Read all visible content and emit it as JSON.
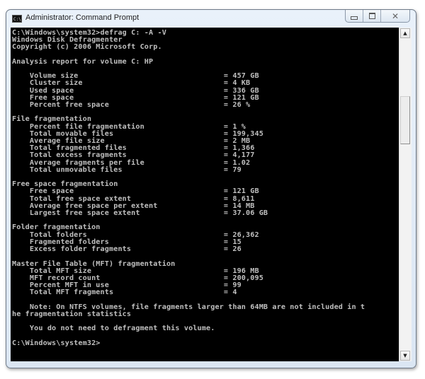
{
  "window": {
    "title": "Administrator: Command Prompt",
    "icon": "cmd-icon",
    "icon_text": "C:\\.",
    "controls": {
      "minimize": "minimize-icon",
      "maximize": "maximize-icon",
      "close": "close-icon",
      "close_glyph": "✕"
    }
  },
  "console": {
    "lines": [
      "C:\\Windows\\system32>defrag C: -A -V",
      "Windows Disk Defragmenter",
      "Copyright (c) 2006 Microsoft Corp.",
      "",
      "Analysis report for volume C: HP",
      "",
      "    Volume size                                 = 457 GB",
      "    Cluster size                                = 4 KB",
      "    Used space                                  = 336 GB",
      "    Free space                                  = 121 GB",
      "    Percent free space                          = 26 %",
      "",
      "File fragmentation",
      "    Percent file fragmentation                  = 1 %",
      "    Total movable files                         = 199,345",
      "    Average file size                           = 2 MB",
      "    Total fragmented files                      = 1,366",
      "    Total excess fragments                      = 4,177",
      "    Average fragments per file                  = 1.02",
      "    Total unmovable files                       = 79",
      "",
      "Free space fragmentation",
      "    Free space                                  = 121 GB",
      "    Total free space extent                     = 8,611",
      "    Average free space per extent               = 14 MB",
      "    Largest free space extent                   = 37.06 GB",
      "",
      "Folder fragmentation",
      "    Total folders                               = 26,362",
      "    Fragmented folders                          = 15",
      "    Excess folder fragments                     = 26",
      "",
      "Master File Table (MFT) fragmentation",
      "    Total MFT size                              = 196 MB",
      "    MFT record count                            = 200,095",
      "    Percent MFT in use                          = 99",
      "    Total MFT fragments                         = 4",
      "",
      "    Note: On NTFS volumes, file fragments larger than 64MB are not included in t",
      "he fragmentation statistics",
      "",
      "    You do not need to defragment this volume.",
      "",
      "C:\\Windows\\system32>"
    ]
  },
  "scrollbar": {
    "up_glyph": "▲",
    "down_glyph": "▼",
    "position_fraction": 0.22
  }
}
